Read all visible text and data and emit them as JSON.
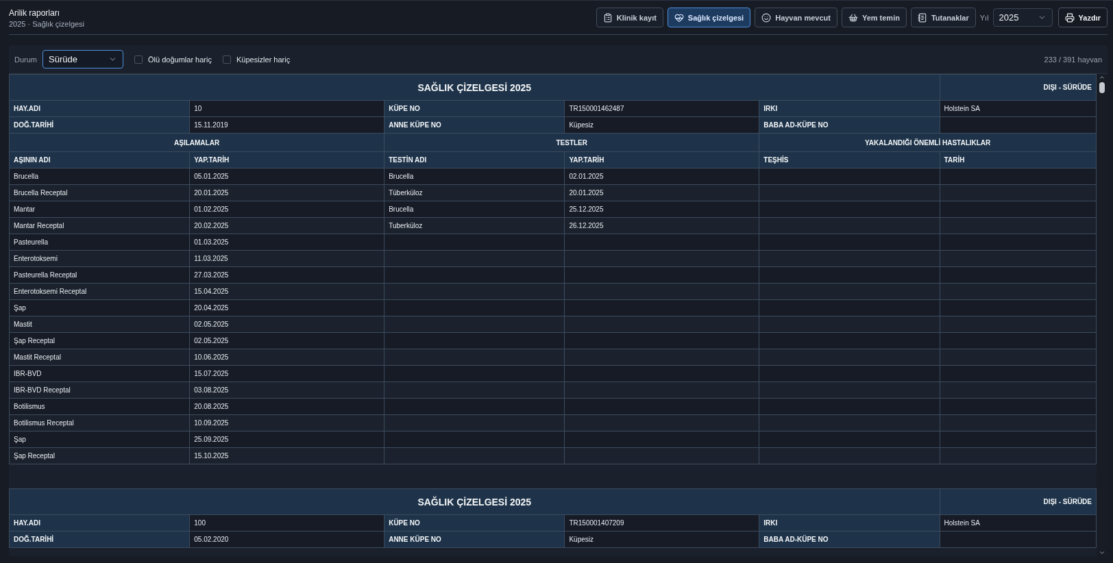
{
  "header": {
    "title": "Arilik raporları",
    "subtitle": "2025 · Sağlık çizelgesi"
  },
  "tabs": [
    {
      "label": "Klinik kayıt",
      "selected": false
    },
    {
      "label": "Sağlık çizelgesi",
      "selected": true
    },
    {
      "label": "Hayvan mevcut",
      "selected": false
    },
    {
      "label": "Yem temin",
      "selected": false
    },
    {
      "label": "Tutanaklar",
      "selected": false
    }
  ],
  "year": {
    "label": "Yıl",
    "value": "2025"
  },
  "print_button": "Yazdır",
  "filters": {
    "status_label": "Durum",
    "status_value": "Sürüde",
    "checkboxes": [
      {
        "label": "Ölü doğumlar hariç",
        "checked": false
      },
      {
        "label": "Küpesizler hariç",
        "checked": false
      }
    ],
    "count": "233 / 391 hayvan"
  },
  "sheets": [
    {
      "title": "SAĞLIK ÇİZELGESİ 2025",
      "status": "DIŞI - SÜRÜDE",
      "info_rows": [
        [
          {
            "label": "HAY.ADI",
            "value": "10"
          },
          {
            "label": "KÜPE NO",
            "value": "TR150001462487"
          },
          {
            "label": "IRKI",
            "value": "Holstein SA"
          }
        ],
        [
          {
            "label": "DOĞ.TARİHİ",
            "value": "15.11.2019"
          },
          {
            "label": "ANNE KÜPE NO",
            "value": "Küpesiz"
          },
          {
            "label": "BABA AD-KÜPE NO"
          }
        ]
      ],
      "sections": [
        "AŞILAMALAR",
        "TESTLER",
        "YAKALANDIĞI ÖNEMLİ HASTALIKLAR"
      ],
      "columns": [
        "AŞININ ADI",
        "YAP.TARİH",
        "TESTİN ADI",
        "YAP.TARİH",
        "TEŞHİS",
        "TARİH"
      ],
      "vaccinations": [
        {
          "name": "Brucella",
          "date": "05.01.2025"
        },
        {
          "name": "Brucella Receptal",
          "date": "20.01.2025"
        },
        {
          "name": "Mantar",
          "date": "01.02.2025"
        },
        {
          "name": "Mantar Receptal",
          "date": "20.02.2025"
        },
        {
          "name": "Pasteurella",
          "date": "01.03.2025"
        },
        {
          "name": "Enterotoksemi",
          "date": "11.03.2025"
        },
        {
          "name": "Pasteurella Receptal",
          "date": "27.03.2025"
        },
        {
          "name": "Enterotoksemi Receptal",
          "date": "15.04.2025"
        },
        {
          "name": "Şap",
          "date": "20.04.2025"
        },
        {
          "name": "Mastit",
          "date": "02.05.2025"
        },
        {
          "name": "Şap Receptal",
          "date": "02.05.2025"
        },
        {
          "name": "Mastit Receptal",
          "date": "10.06.2025"
        },
        {
          "name": "IBR-BVD",
          "date": "15.07.2025"
        },
        {
          "name": "IBR-BVD Receptal",
          "date": "03.08.2025"
        },
        {
          "name": "Botilismus",
          "date": "20.08.2025"
        },
        {
          "name": "Botilismus Receptal",
          "date": "10.09.2025"
        },
        {
          "name": "Şap",
          "date": "25.09.2025"
        },
        {
          "name": "Şap Receptal",
          "date": "15.10.2025"
        }
      ],
      "tests": [
        {
          "name": "Brucella",
          "date": "02.01.2025"
        },
        {
          "name": "Tüberküloz",
          "date": "20.01.2025"
        },
        {
          "name": "Brucella",
          "date": "25.12.2025"
        },
        {
          "name": "Tuberküloz",
          "date": "26.12.2025"
        }
      ]
    },
    {
      "title": "SAĞLIK ÇİZELGESİ 2025",
      "status": "DIŞI - SÜRÜDE",
      "info_rows": [
        [
          {
            "label": "HAY.ADI",
            "value": "100"
          },
          {
            "label": "KÜPE NO",
            "value": "TR150001407209"
          },
          {
            "label": "IRKI",
            "value": "Holstein SA"
          }
        ],
        [
          {
            "label": "DOĞ.TARİHİ",
            "value": "05.02.2020"
          },
          {
            "label": "ANNE KÜPE NO",
            "value": "Küpesiz"
          },
          {
            "label": "BABA AD-KÜPE NO"
          }
        ]
      ]
    }
  ]
}
